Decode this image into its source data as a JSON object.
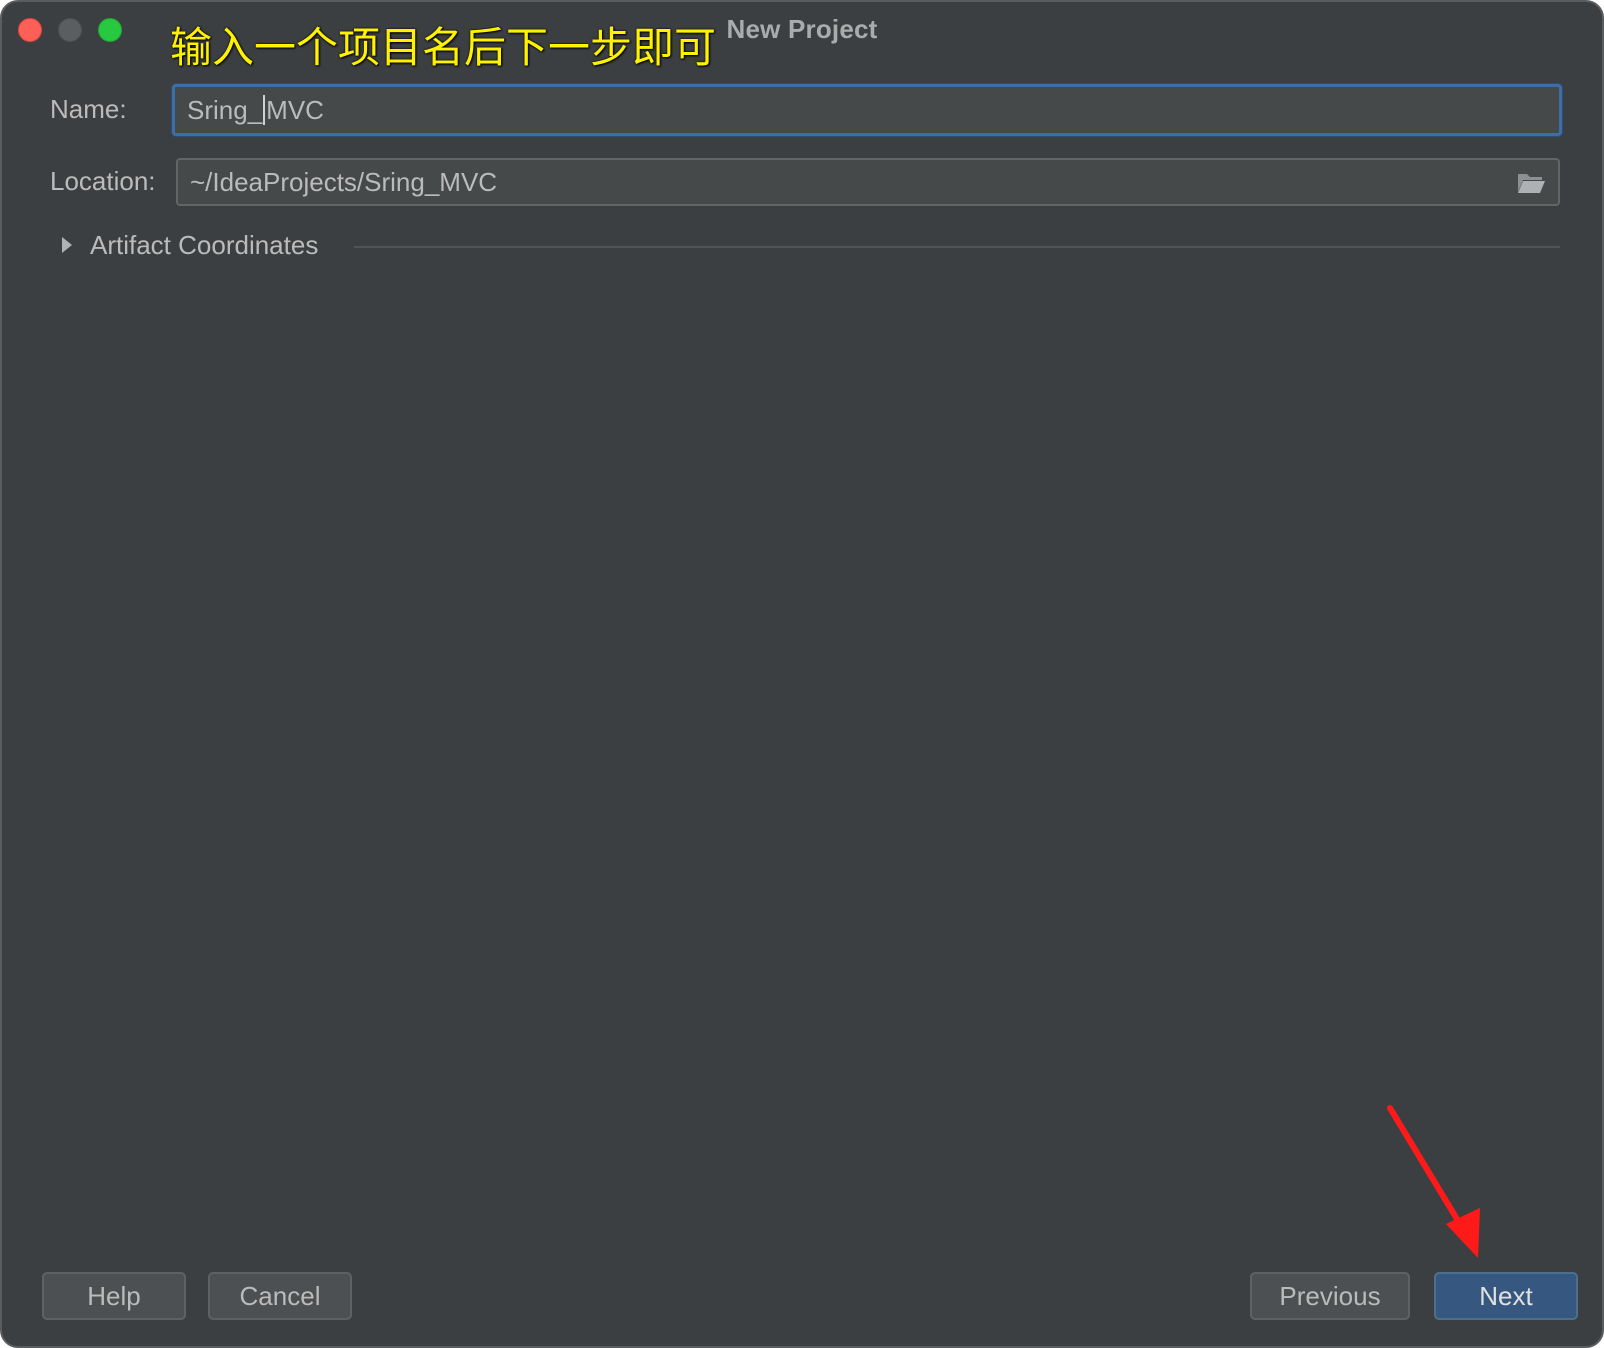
{
  "window": {
    "title": "New Project"
  },
  "annotation": {
    "text": "输入一个项目名后下一步即可"
  },
  "form": {
    "name_label": "Name:",
    "name_value_before_caret": "Sring_",
    "name_value_after_caret": "MVC",
    "location_label": "Location:",
    "location_value": "~/IdeaProjects/Sring_MVC"
  },
  "section": {
    "artifact_label": "Artifact Coordinates",
    "expanded": false
  },
  "buttons": {
    "help": "Help",
    "cancel": "Cancel",
    "previous": "Previous",
    "next": "Next"
  },
  "colors": {
    "background": "#3c3f41",
    "focus_border": "#3d6ea5",
    "primary_button": "#365880",
    "annotation_text": "#fff200",
    "annotation_arrow": "#ff1a1a"
  },
  "icons": {
    "location_browse": "folder-open-icon",
    "section_toggle": "triangle-right-icon"
  }
}
